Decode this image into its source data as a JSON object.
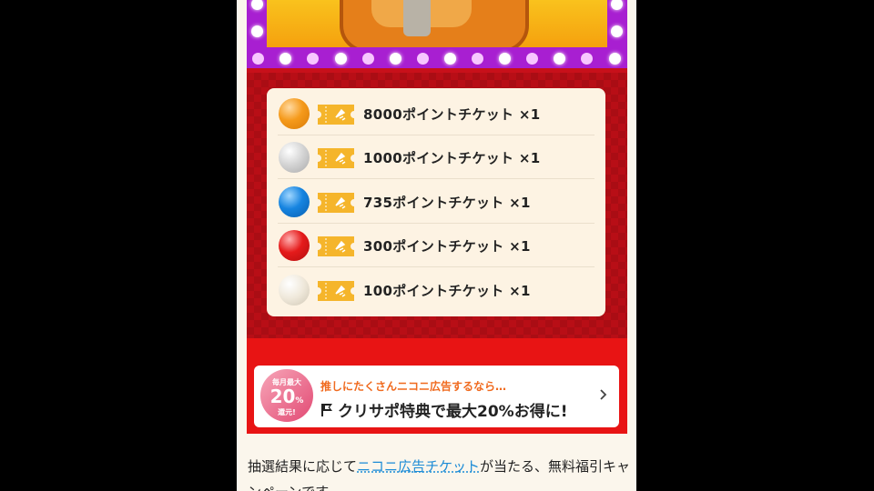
{
  "prizes": [
    {
      "label": "8000ポイントチケット ×1",
      "ball_color": "#f59a1b",
      "ball_name": "orange-ball-icon"
    },
    {
      "label": "1000ポイントチケット ×1",
      "ball_color": "#c9c9c9",
      "ball_name": "silver-ball-icon"
    },
    {
      "label": "735ポイントチケット ×1",
      "ball_color": "#1684e0",
      "ball_name": "blue-ball-icon"
    },
    {
      "label": "300ポイントチケット ×1",
      "ball_color": "#e51b1b",
      "ball_name": "red-ball-icon"
    },
    {
      "label": "100ポイントチケット ×1",
      "ball_color": "#ece5d6",
      "ball_name": "white-ball-icon"
    }
  ],
  "ad": {
    "badge_top": "毎月最大",
    "badge_big": "20",
    "badge_pct": "%",
    "badge_bottom": "還元!",
    "top_text": "推しにたくさんニコニ広告するなら…",
    "main_text": "クリサポ特典で最大20%お得に!"
  },
  "body": {
    "line1_pre": "抽選結果に応じて",
    "line1_link": "ニコニ広告チケット",
    "line1_post": "が当たる、無料福引キャ",
    "line2": "ンペーンです。"
  },
  "colors": {
    "marquee": "#a81fd1",
    "banner_red": "#c8101a",
    "ticket_gold": "#f5b52b",
    "link": "#1b8bd6"
  }
}
